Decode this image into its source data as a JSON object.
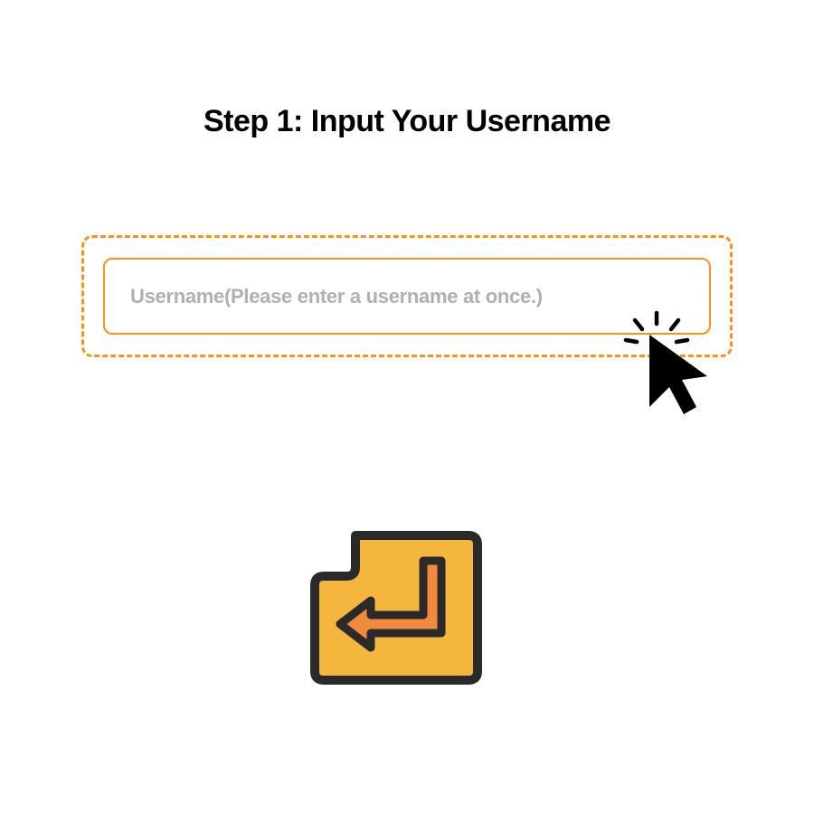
{
  "heading": "Step 1: Input Your Username",
  "input": {
    "placeholder": "Username(Please enter a username at once.)"
  },
  "colors": {
    "accent": "#f7941d",
    "enter_fill": "#f5b63e",
    "enter_arrow": "#f08a3c",
    "outline": "#2a2a2a"
  }
}
